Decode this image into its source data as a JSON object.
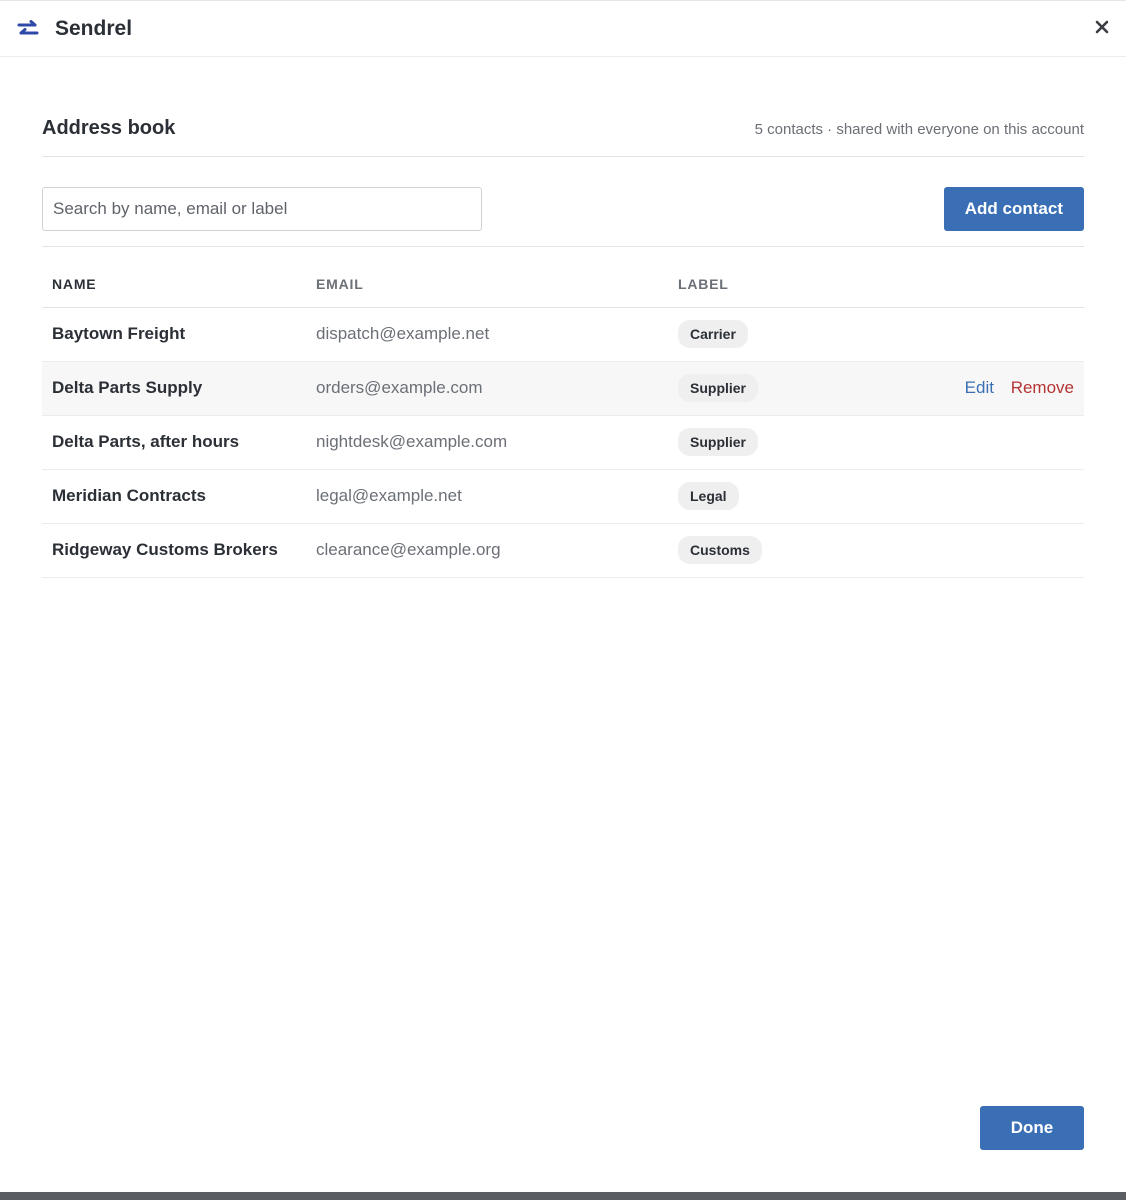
{
  "app": {
    "title": "Sendrel",
    "icon": "swap-arrows-icon",
    "accent": "#3a6fb5"
  },
  "page": {
    "title": "Address book",
    "subtitle": "5 contacts · shared with everyone on this account"
  },
  "search": {
    "placeholder": "Search by name, email or label",
    "value": ""
  },
  "toolbar": {
    "add_label": "Add contact"
  },
  "table": {
    "headers": {
      "name": "NAME",
      "email": "EMAIL",
      "label": "LABEL"
    },
    "rows": [
      {
        "name": "Baytown Freight",
        "email": "dispatch@example.net",
        "label": "Carrier"
      },
      {
        "name": "Delta Parts Supply",
        "email": "orders@example.com",
        "label": "Supplier",
        "edit": "Edit",
        "remove": "Remove"
      },
      {
        "name": "Delta Parts, after hours",
        "email": "nightdesk@example.com",
        "label": "Supplier"
      },
      {
        "name": "Meridian Contracts",
        "email": "legal@example.net",
        "label": "Legal"
      },
      {
        "name": "Ridgeway Customs Brokers",
        "email": "clearance@example.org",
        "label": "Customs"
      }
    ]
  },
  "footer": {
    "done_label": "Done"
  },
  "colors": {
    "primary": "#3a6fb5",
    "danger": "#b43434",
    "icon_blue": "#2f49a8"
  }
}
